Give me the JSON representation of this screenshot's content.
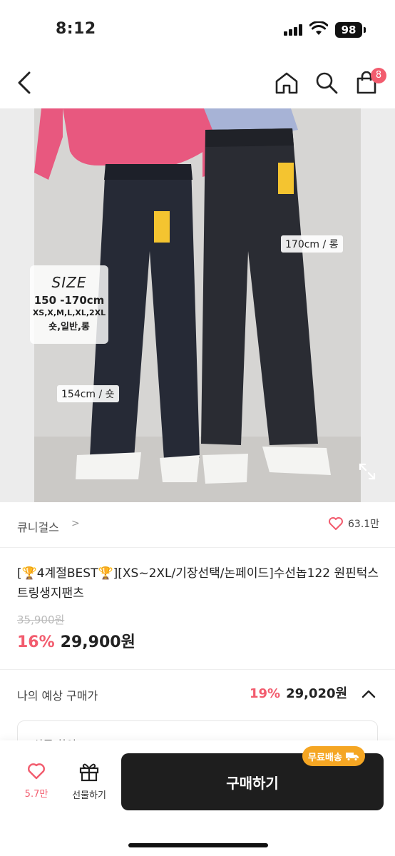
{
  "status": {
    "time": "8:12",
    "battery": "98"
  },
  "nav": {
    "cart_count": "8"
  },
  "image": {
    "size_title": "SIZE",
    "size_range": "150 -170cm",
    "size_list": "XS,X,M,L,XL,2XL",
    "size_lengths": "숏,일반,롱",
    "label_long": "170cm / 롱",
    "label_short": "154cm / 숏"
  },
  "brand": {
    "name": "큐니걸스",
    "chevron": ">",
    "likes": "63.1만"
  },
  "product": {
    "title": "[🏆4계절BEST🏆][XS~2XL/기장선택/논페이드]수선놉122 원핀턱스트링생지팬츠",
    "original_price": "35,900원",
    "discount": "16%",
    "price": "29,900원"
  },
  "estimate": {
    "label": "나의 예상 구매가",
    "discount": "19%",
    "price": "29,020원"
  },
  "partial_card": {
    "text": "상품 확인"
  },
  "bottom": {
    "likes": "5.7만",
    "gift_label": "선물하기",
    "buy_label": "구매하기",
    "shipping_badge": "무료배송"
  },
  "colors": {
    "accent": "#f25c6e",
    "buy_button": "#1e1e1e",
    "shipping_badge": "#f5a623"
  }
}
